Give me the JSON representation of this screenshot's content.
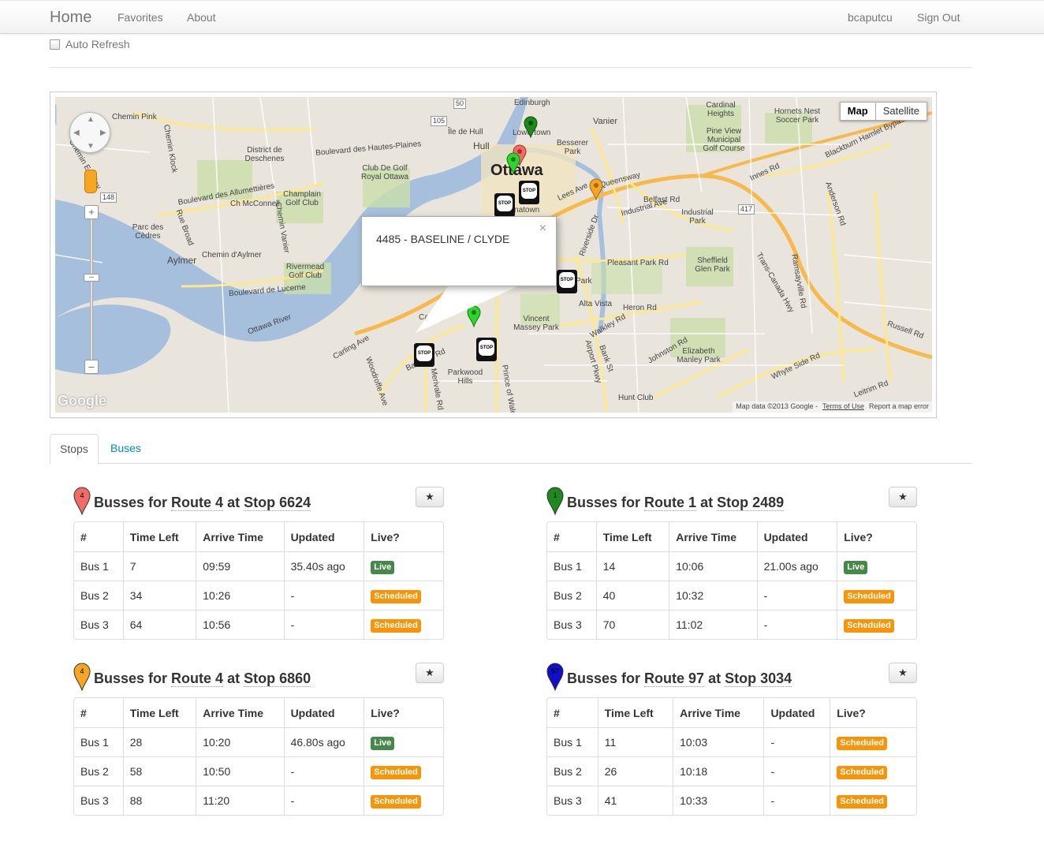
{
  "navbar": {
    "brand": "Home",
    "links": [
      "Favorites",
      "About"
    ],
    "user": "bcaputcu",
    "sign_out": "Sign Out"
  },
  "auto_refresh": {
    "label": "Auto Refresh",
    "checked": false
  },
  "map": {
    "type_buttons": [
      "Map",
      "Satellite"
    ],
    "info_window": {
      "text": "4485 - BASELINE / CLYDE"
    },
    "footer": {
      "data": "Map data ©2013 Google -",
      "terms": "Terms of Use",
      "report": "Report a map error"
    },
    "logo": "Google",
    "city": "Ottawa",
    "labels": [
      "Chemin Pink",
      "Edinburgh",
      "Vanier",
      "Cardinal Heights",
      "Hornets Nest Soccer Park",
      "Pine View Municipal Golf Course",
      "Hull",
      "Île de Hull",
      "District de Deschenes",
      "Club De Golf Royal Ottawa",
      "Champlain Golf Club",
      "Parc des Cèdres",
      "Aylmer",
      "Rivermead Golf Club",
      "Lowertown",
      "Besserer Park",
      "Chinatown",
      "Industrial Park",
      "Sheffield Glen Park",
      "Alta Vista",
      "Vincent Massey Park",
      "Carling",
      "Parkwood Hills",
      "Elizabeth Manley Park",
      "Hunt Club",
      "Ottawa River",
      "Queensway",
      "Lees Ave",
      "Riverside Dr",
      "Pleasant Park Rd",
      "Heron Rd",
      "Walkley Rd",
      "Bank St",
      "Johnston Rd",
      "Anderson Rd",
      "Russell Rd",
      "Innes Rd",
      "Blackburn Hamlet Bypass",
      "Trans-Canada Hwy",
      "Ramsayville Rd",
      "Whyte Side Rd",
      "Leitrim Rd",
      "Airport Pkwy",
      "Carling Ave",
      "Baseline Rd",
      "Merivale Rd",
      "Woodroffe Ave",
      "Prince of Wales Dr",
      "Belfast Rd",
      "Industrial Ave",
      "Park",
      "Chemin Eardley",
      "Chemin Klock",
      "Boulevard des Allumettières",
      "Ch McConnell",
      "Chemin Vanier",
      "Chemin d'Aylmer",
      "Boulevard de Lucerne",
      "Rue Broad",
      "417",
      "148",
      "105",
      "50",
      "Boulevard des Hautes-Plaines"
    ]
  },
  "tabs": [
    "Stops",
    "Buses"
  ],
  "panels": [
    {
      "title_prefix": "Busses for ",
      "route": "Route 4",
      "mid": " at ",
      "stop": "Stop 6624",
      "pin_color": "#f06c64",
      "pin_label": "4",
      "star": "★",
      "headers": [
        "#",
        "Time Left",
        "Arrive Time",
        "Updated",
        "Live?"
      ],
      "rows": [
        [
          "Bus 1",
          "7",
          "09:59",
          "35.40s ago",
          "Live"
        ],
        [
          "Bus 2",
          "34",
          "10:26",
          "-",
          "Scheduled"
        ],
        [
          "Bus 3",
          "64",
          "10:56",
          "-",
          "Scheduled"
        ]
      ]
    },
    {
      "title_prefix": "Busses for ",
      "route": "Route 1",
      "mid": " at ",
      "stop": "Stop 2489",
      "pin_color": "#1e8a1e",
      "pin_label": "1",
      "star": "★",
      "headers": [
        "#",
        "Time Left",
        "Arrive Time",
        "Updated",
        "Live?"
      ],
      "rows": [
        [
          "Bus 1",
          "14",
          "10:06",
          "21.00s ago",
          "Live"
        ],
        [
          "Bus 2",
          "40",
          "10:32",
          "-",
          "Scheduled"
        ],
        [
          "Bus 3",
          "70",
          "11:02",
          "-",
          "Scheduled"
        ]
      ]
    },
    {
      "title_prefix": "Busses for ",
      "route": "Route 4",
      "mid": " at ",
      "stop": "Stop 6860",
      "pin_color": "#f5a623",
      "pin_label": "4",
      "star": "★",
      "headers": [
        "#",
        "Time Left",
        "Arrive Time",
        "Updated",
        "Live?"
      ],
      "rows": [
        [
          "Bus 1",
          "28",
          "10:20",
          "46.80s ago",
          "Live"
        ],
        [
          "Bus 2",
          "58",
          "10:50",
          "-",
          "Scheduled"
        ],
        [
          "Bus 3",
          "88",
          "11:20",
          "-",
          "Scheduled"
        ]
      ]
    },
    {
      "title_prefix": "Busses for ",
      "route": "Route 97",
      "mid": " at ",
      "stop": "Stop 3034",
      "pin_color": "#1010c8",
      "pin_label": "97",
      "star": "★",
      "headers": [
        "#",
        "Time Left",
        "Arrive Time",
        "Updated",
        "Live?"
      ],
      "rows": [
        [
          "Bus 1",
          "11",
          "10:03",
          "-",
          "Scheduled"
        ],
        [
          "Bus 2",
          "26",
          "10:18",
          "-",
          "Scheduled"
        ],
        [
          "Bus 3",
          "41",
          "10:33",
          "-",
          "Scheduled"
        ]
      ]
    }
  ],
  "colors": {
    "live": "#468847",
    "scheduled": "#f89406",
    "link": "#0088cc"
  }
}
